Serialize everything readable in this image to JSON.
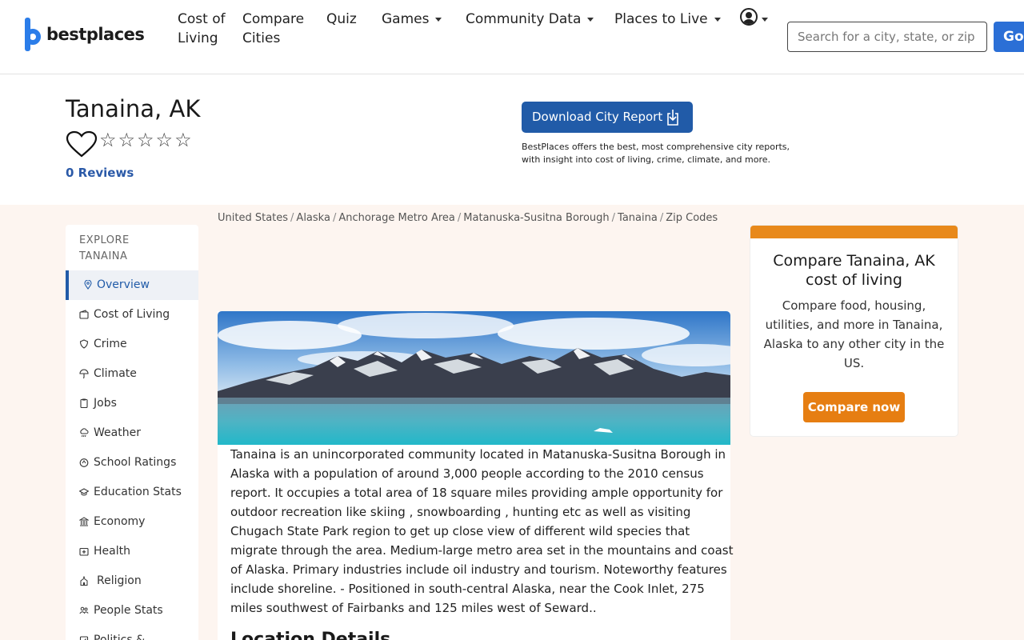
{
  "header": {
    "logo_text": "bestplaces",
    "nav": [
      {
        "label": "Cost of Living",
        "dropdown": false
      },
      {
        "label": "Compare Cities",
        "dropdown": false
      },
      {
        "label": "Quiz",
        "dropdown": false
      },
      {
        "label": "Games",
        "dropdown": true
      },
      {
        "label": "Community Data",
        "dropdown": true
      },
      {
        "label": "Places to Live",
        "dropdown": true
      }
    ],
    "search_placeholder": "Search for a city, state, or zip",
    "go_label": "Go"
  },
  "title_band": {
    "city": "Tanaina, AK",
    "stars": "☆☆☆☆☆",
    "reviews": "0 Reviews",
    "download_label": "Download City Report",
    "download_desc": "BestPlaces offers the best, most comprehensive city reports, with insight into cost of living, crime, climate, and more."
  },
  "sidebar": {
    "heading": "EXPLORE TANAINA",
    "items": [
      {
        "label": "Overview",
        "icon": "pin-icon"
      },
      {
        "label": "Cost of Living",
        "icon": "wallet-icon"
      },
      {
        "label": "Crime",
        "icon": "shield-icon"
      },
      {
        "label": "Climate",
        "icon": "umbrella-icon"
      },
      {
        "label": "Jobs",
        "icon": "clipboard-icon"
      },
      {
        "label": "Weather",
        "icon": "cloud-rain-icon"
      },
      {
        "label": "School Ratings",
        "icon": "grade-icon"
      },
      {
        "label": "Education Stats",
        "icon": "graduation-cap-icon"
      },
      {
        "label": "Economy",
        "icon": "bank-icon"
      },
      {
        "label": "Health",
        "icon": "medical-kit-icon"
      },
      {
        "label": "Religion",
        "icon": "church-icon"
      },
      {
        "label": "People Stats",
        "icon": "people-icon"
      },
      {
        "label": "Politics &",
        "icon": "vote-icon"
      }
    ]
  },
  "breadcrumb": [
    "United States",
    "Alaska",
    "Anchorage Metro Area",
    "Matanuska-Susitna Borough",
    "Tanaina",
    "Zip Codes"
  ],
  "content": {
    "description": "Tanaina is an unincorporated community located in Matanuska-Susitna Borough in Alaska with a population of around 3,000 people according to the 2010 census report. It occupies a total area of 18 square miles providing ample opportunity for outdoor recreation like skiing , snowboarding , hunting etc as well as visiting Chugach State Park region to get up close view of different wild species that migrate through the area. Medium-large metro area set in the mountains and coast of Alaska. Primary industries include oil industry and tourism. Noteworthy features include shoreline. - Positioned in south-central Alaska, near the Cook Inlet, 275 miles southwest of Fairbanks and 125 miles west of Seward..",
    "section_title": "Location Details"
  },
  "compare": {
    "title": "Compare Tanaina, AK cost of living",
    "text": "Compare food, housing, utilities, and more in Tanaina, Alaska to any other city in the US.",
    "button": "Compare now"
  }
}
